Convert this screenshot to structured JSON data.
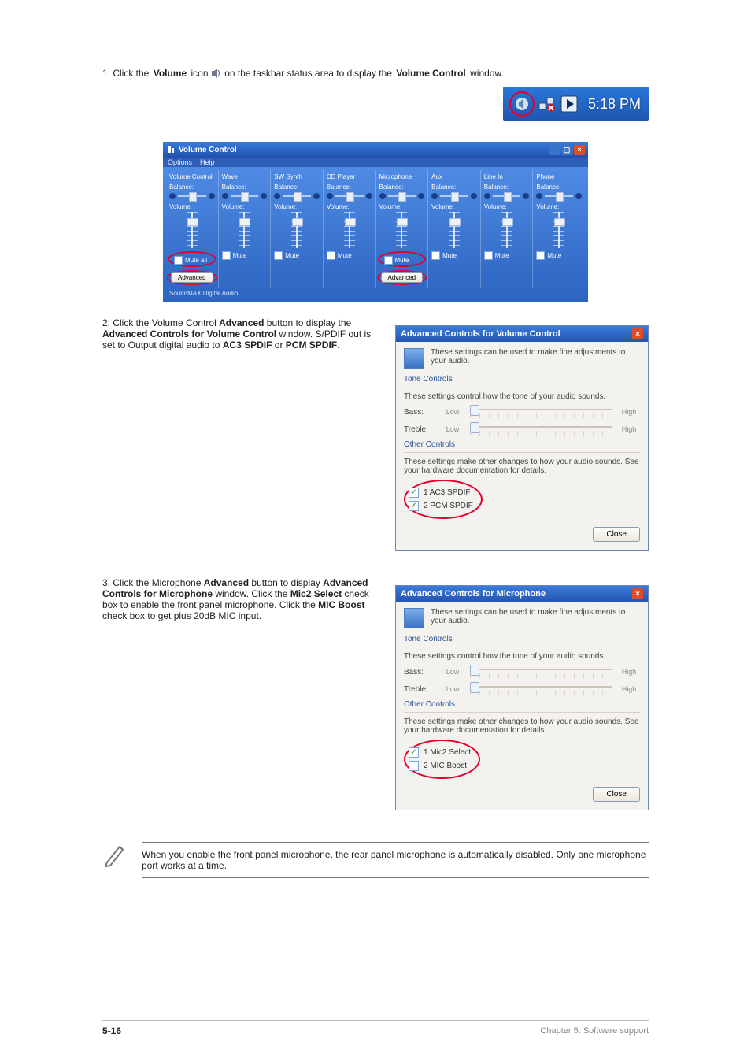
{
  "step1_prefix": "1. Click the ",
  "step1_bold_a": "Volume",
  "step1_mid": " icon ",
  "step1_suffix": " on the taskbar status area to display the ",
  "step1_bold_b": "Volume Control",
  "step1_end": " window.",
  "taskbar": {
    "time": "5:18 PM"
  },
  "volume_window": {
    "title": "Volume Control",
    "menu_options": "Options",
    "menu_help": "Help",
    "status": "SoundMAX Digital Audio",
    "columns": [
      {
        "name": "Volume Control",
        "mute": "Mute all",
        "advanced": "Advanced"
      },
      {
        "name": "Wave",
        "mute": "Mute"
      },
      {
        "name": "SW Synth",
        "mute": "Mute"
      },
      {
        "name": "CD Player",
        "mute": "Mute"
      },
      {
        "name": "Microphone",
        "mute": "Mute",
        "advanced": "Advanced"
      },
      {
        "name": "Aux",
        "mute": "Mute"
      },
      {
        "name": "Line In",
        "mute": "Mute"
      },
      {
        "name": "Phone",
        "mute": "Mute"
      }
    ],
    "balance_label": "Balance:",
    "volume_label": "Volume:"
  },
  "step2_text_a": "2. Click the Volume Control ",
  "step2_bold": "Advanced",
  "step2_text_b": " button to display the ",
  "step2_bold2": "Advanced Controls for Volume Control",
  "step2_text_c": " window. S/PDIF out is set to Output digital audio to ",
  "step2_bold3": "AC3 SPDIF",
  "step2_text_d": " or ",
  "step2_bold4": "PCM SPDIF",
  "step2_text_e": ".",
  "adv_volume": {
    "title": "Advanced Controls for Volume Control",
    "info": "These settings can be used to make fine adjustments to your audio.",
    "group_tone": "Tone Controls",
    "tone_desc": "These settings control how the tone of your audio sounds.",
    "bass": "Bass:",
    "treble": "Treble:",
    "low": "Low",
    "high": "High",
    "group_other": "Other Controls",
    "other_desc": "These settings make other changes to how your audio sounds. See your hardware documentation for details.",
    "opt1": "1  AC3 SPDIF",
    "opt2": "2  PCM SPDIF",
    "close": "Close"
  },
  "step3_text_a": "3. Click the Microphone ",
  "step3_bold": "Advanced",
  "step3_text_b": " button to display ",
  "step3_bold2": "Advanced Controls for Microphone",
  "step3_text_c": " window. Click the ",
  "step3_bold3": "Mic2 Select",
  "step3_text_d": " check box to enable the front panel microphone. Click the ",
  "step3_bold4": "MIC Boost",
  "step3_text_e": " check box to get plus 20dB MIC input.",
  "adv_mic": {
    "title": "Advanced Controls for Microphone",
    "info": "These settings can be used to make fine adjustments to your audio.",
    "group_tone": "Tone Controls",
    "tone_desc": "These settings control how the tone of your audio sounds.",
    "bass": "Bass:",
    "treble": "Treble:",
    "low": "Low",
    "high": "High",
    "group_other": "Other Controls",
    "other_desc": "These settings make other changes to how your audio sounds. See your hardware documentation for details.",
    "opt1": "1  Mic2 Select",
    "opt2": "2  MIC Boost",
    "close": "Close"
  },
  "note": "When you enable the front panel microphone, the rear panel microphone is automatically disabled. Only one microphone port works at a time.",
  "footer_left_bold": "5-16",
  "footer_right": "Chapter 5: Software support"
}
